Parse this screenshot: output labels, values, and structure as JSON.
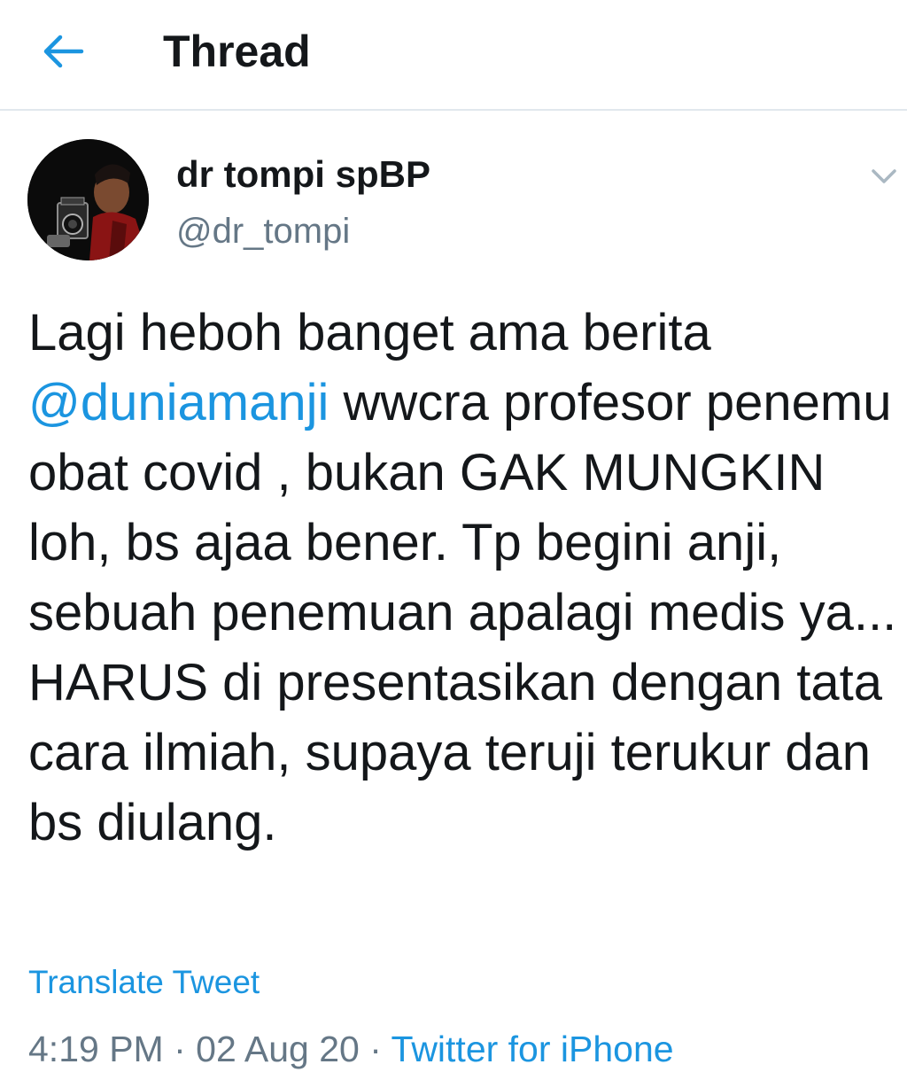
{
  "header": {
    "back_icon": "arrow-left-icon",
    "title": "Thread"
  },
  "tweet": {
    "avatar_icon": "profile-photo",
    "display_name": "dr tompi spBP",
    "handle": "@dr_tompi",
    "menu_icon": "chevron-down-icon",
    "text_before_mention": "Lagi heboh banget ama berita ",
    "mention": "@duniamanji",
    "text_after_mention": " wwcra profesor penemu obat covid , bukan GAK MUNGKIN loh, bs ajaa bener. Tp begini anji, sebuah penemuan apalagi medis ya... HARUS di presentasikan dengan tata cara ilmiah, supaya teruji terukur dan bs diulang.",
    "translate_label": "Translate Tweet",
    "time": "4:19 PM",
    "separator": " · ",
    "date": "02 Aug 20",
    "source": "Twitter for iPhone"
  },
  "colors": {
    "accent": "#1b95e0",
    "text": "#14171a",
    "secondary": "#657786",
    "divider": "#e1e8ed"
  }
}
